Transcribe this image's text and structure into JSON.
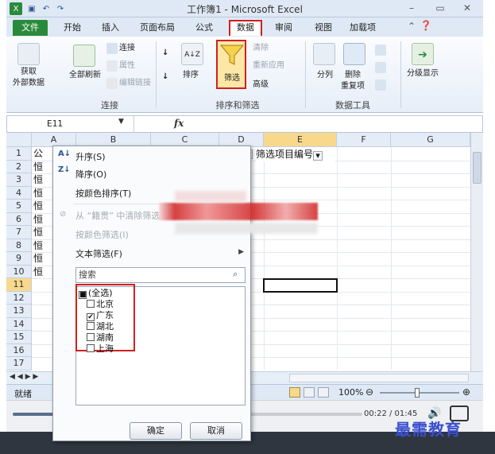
{
  "window": {
    "title": "工作簿1 - Microsoft Excel"
  },
  "ribbon_tabs": [
    "文件",
    "开始",
    "插入",
    "页面布局",
    "公式",
    "数据",
    "审阅",
    "视图",
    "加载项"
  ],
  "ribbon": {
    "get_external": "获取\n外部数据",
    "refresh_all": "全部刷新",
    "connections": "连接",
    "properties": "属性",
    "edit_links": "编辑链接",
    "group_connections": "连接",
    "sort_az": "A↓Z",
    "sort": "排序",
    "filter": "筛选",
    "clear": "清除",
    "reapply": "重新应用",
    "advanced": "高级",
    "group_sort_filter": "排序和筛选",
    "text_to_columns": "分列",
    "remove_duplicates": "删除\n重复项",
    "group_data_tools": "数据工具",
    "outline": "分级显示"
  },
  "formula_bar": {
    "name_box": "E11",
    "fx": "fx"
  },
  "grid": {
    "columns": [
      "A",
      "B",
      "C",
      "D",
      "E",
      "F",
      "G"
    ],
    "rows": [
      "1",
      "2",
      "3",
      "4",
      "5",
      "6",
      "7",
      "8",
      "9",
      "10",
      "11",
      "12",
      "13",
      "14",
      "15",
      "16",
      "17"
    ],
    "col_a_values": [
      "公",
      "恒",
      "恒",
      "恒",
      "恒",
      "恒",
      "恒",
      "恒",
      "恒",
      "恒"
    ],
    "header_e": "筛选项目编号",
    "selected_cell": "E11"
  },
  "filter_menu": {
    "sort_asc": "升序(S)",
    "sort_desc": "降序(O)",
    "sort_by_color": "按颜色排序(T)",
    "clear_filter": "从 “籍贯” 中清除筛选",
    "filter_by_color": "按颜色筛选(I)",
    "text_filter": "文本筛选(F)",
    "search_placeholder": "搜索",
    "items": [
      {
        "label": "(全选)",
        "state": "partial"
      },
      {
        "label": "北京",
        "state": "unchecked"
      },
      {
        "label": "广东",
        "state": "checked"
      },
      {
        "label": "湖北",
        "state": "unchecked"
      },
      {
        "label": "湖南",
        "state": "unchecked"
      },
      {
        "label": "上海",
        "state": "unchecked"
      }
    ],
    "ok": "确定",
    "cancel": "取消"
  },
  "status": {
    "ready": "就绪",
    "zoom": "100%"
  },
  "player": {
    "time": "00:22 / 01:45"
  },
  "watermark": "最需教育",
  "colors": {
    "accent_red": "#d02020",
    "file_tab": "#2a8a3c",
    "watermark": "#3b4fd0"
  }
}
